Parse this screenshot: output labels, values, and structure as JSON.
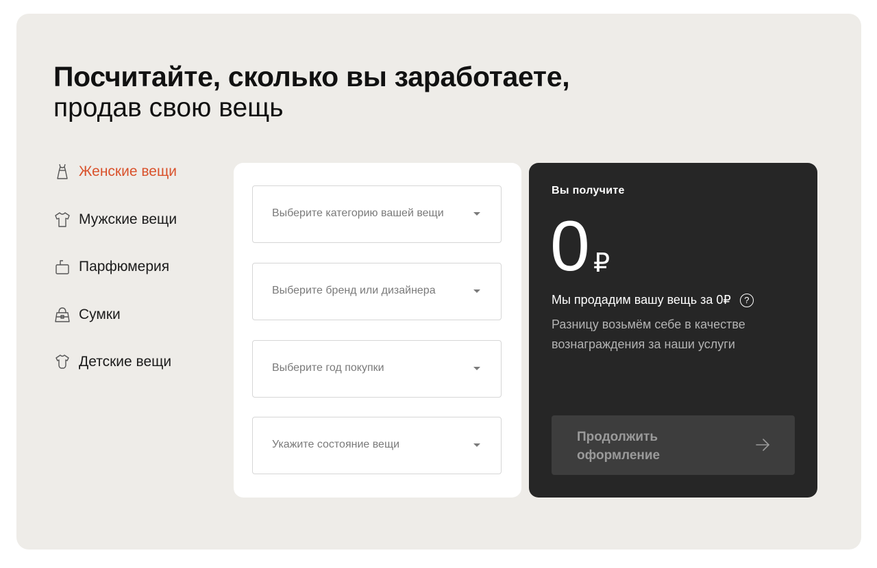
{
  "heading": {
    "line1": "Посчитайте, сколько вы заработаете,",
    "line2": "продав свою вещь"
  },
  "categories": [
    {
      "label": "Женские вещи",
      "icon": "dress-icon",
      "active": true
    },
    {
      "label": "Мужские вещи",
      "icon": "tshirt-icon",
      "active": false
    },
    {
      "label": "Парфюмерия",
      "icon": "perfume-icon",
      "active": false
    },
    {
      "label": "Сумки",
      "icon": "bag-icon",
      "active": false
    },
    {
      "label": "Детские вещи",
      "icon": "bodysuit-icon",
      "active": false
    }
  ],
  "form": {
    "category_placeholder": "Выберите категорию вашей вещи",
    "brand_placeholder": "Выберите бренд или дизайнера",
    "year_placeholder": "Выберите год покупки",
    "condition_placeholder": "Укажите состояние вещи"
  },
  "result": {
    "label": "Вы получите",
    "amount": "0",
    "currency": "₽",
    "sell_text": "Мы продадим вашу вещь за 0₽",
    "help": "?",
    "note": "Разницу возьмём себе в качестве вознаграждения за наши услуги",
    "continue_label": "Продолжить оформление"
  },
  "colors": {
    "accent": "#d9522c",
    "panel": "#eeece8",
    "dark": "#262626",
    "button": "#3d3d3d"
  }
}
